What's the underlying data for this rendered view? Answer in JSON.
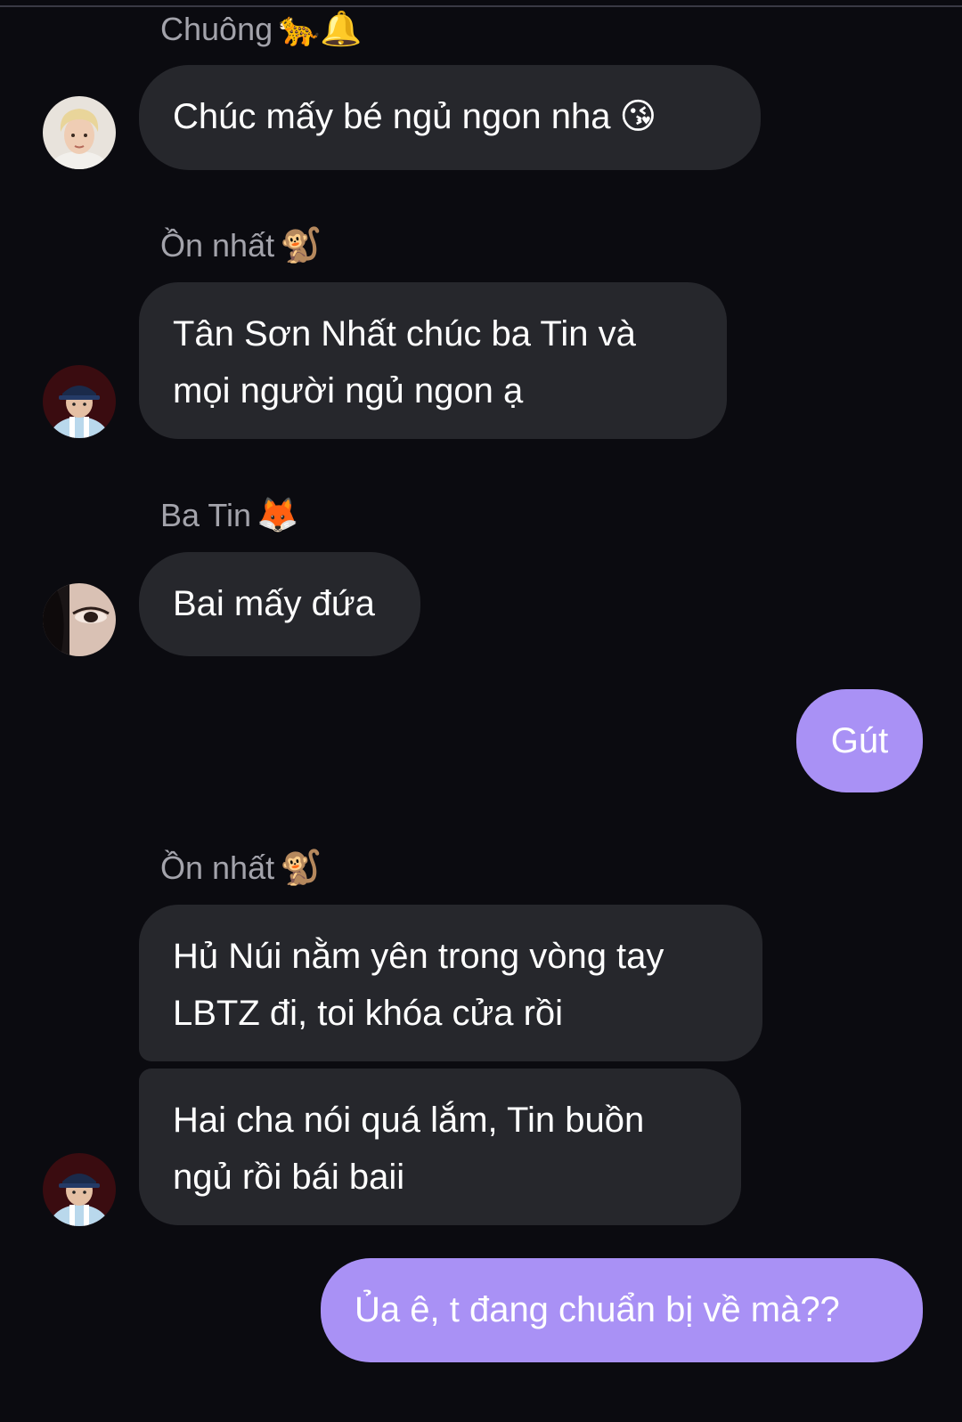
{
  "messages": [
    {
      "sender": "Chuông",
      "sender_emoji": "🐆🔔",
      "text": "Chúc mấy bé ngủ ngon nha",
      "text_emoji": "😘",
      "avatar": "blonde-boy-avatar"
    },
    {
      "sender": "Ồn nhất",
      "sender_emoji": "🐒",
      "lines": [
        "Tân Sơn Nhất chúc ba Tin và",
        "mọi người ngủ ngon ạ"
      ],
      "avatar": "cap-boy-avatar"
    },
    {
      "sender": "Ba Tin",
      "sender_emoji": "🦊",
      "text": "Bai mấy đứa",
      "avatar": "eye-closeup-avatar"
    },
    {
      "mine": true,
      "text": "Gút"
    },
    {
      "sender": "Ồn nhất",
      "sender_emoji": "🐒",
      "lines": [
        "Hủ Núi nằm yên trong vòng tay",
        "LBTZ đi, toi khóa cửa rồi"
      ]
    },
    {
      "lines": [
        "Hai cha nói quá lắm, Tin buồn",
        "ngủ rồi bái baii"
      ],
      "avatar": "cap-boy-avatar"
    },
    {
      "mine": true,
      "text": "Ủa ê, t đang chuẩn bị về mà??"
    }
  ],
  "colors": {
    "background": "#0b0b10",
    "incoming_bubble": "#26272c",
    "outgoing_bubble": "#a991f5",
    "sender_name": "#a3a3ab"
  }
}
